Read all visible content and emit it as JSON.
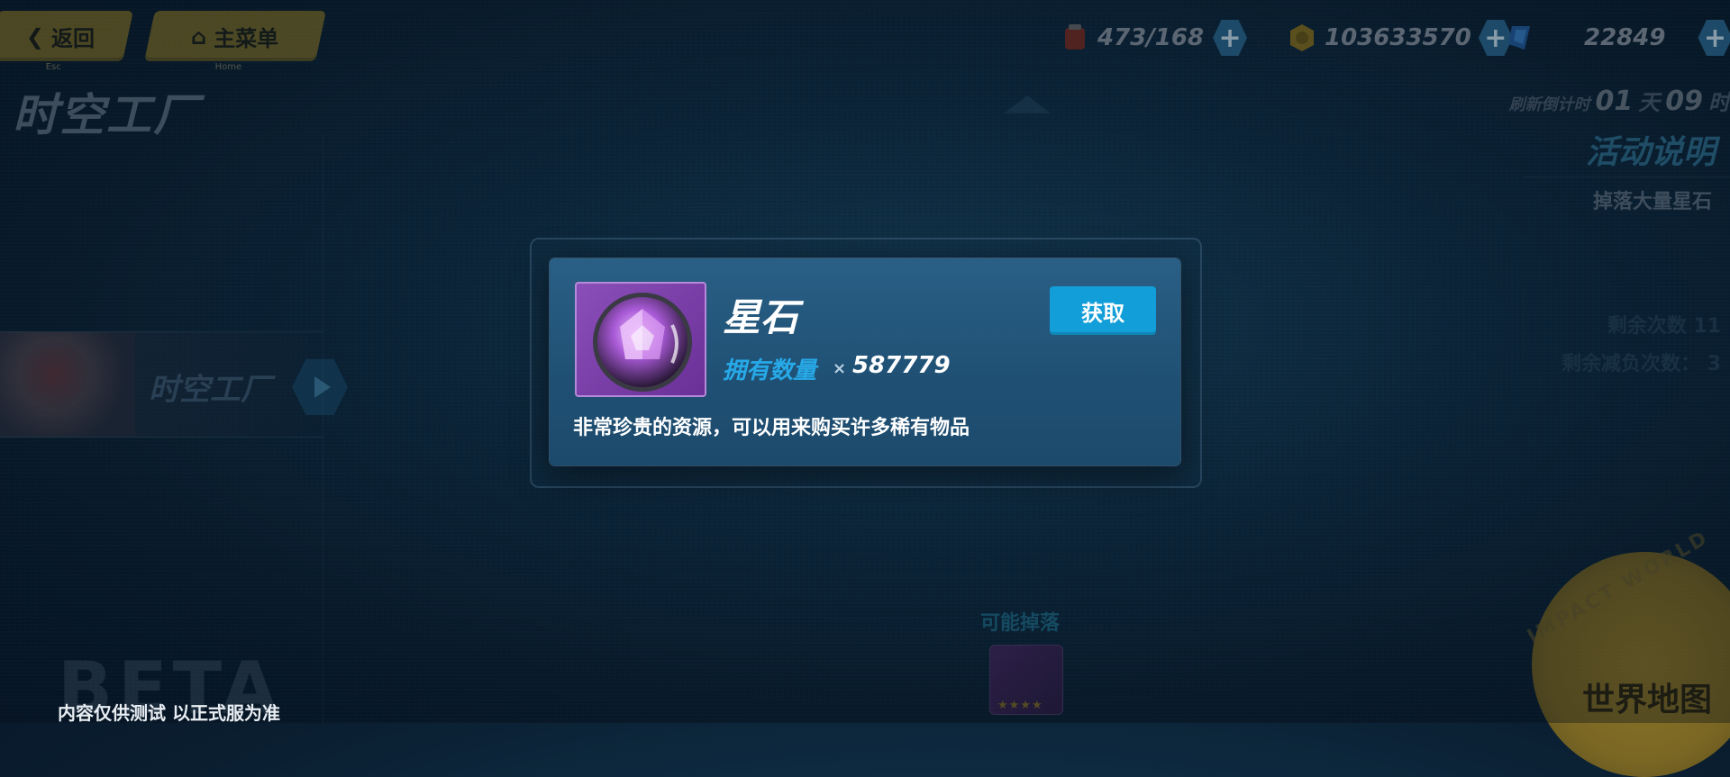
{
  "header": {
    "back": {
      "label": "返回",
      "sub": "Esc"
    },
    "home": {
      "label": "主菜单",
      "sub": "Home"
    },
    "title": "时空工厂"
  },
  "currencies": [
    {
      "name": "stamina",
      "value": "473/168",
      "icon": "stamina-icon",
      "color": "#a83a2a"
    },
    {
      "name": "coins",
      "value": "103633570",
      "icon": "coin-icon",
      "color": "#c9a326"
    },
    {
      "name": "crystals",
      "value": "22849",
      "icon": "crystal-icon",
      "color": "#2f7fd0"
    }
  ],
  "refresh": {
    "label": "刷新倒计时",
    "days": "01",
    "day_unit": "天",
    "hours": "09",
    "hour_unit": "时"
  },
  "activity": {
    "title": "活动说明",
    "desc": "掉落大量星石",
    "remaining_label": "剩余次数",
    "remaining": "11",
    "remaining_reduce_label": "剩余减负次数：",
    "remaining_reduce": "3"
  },
  "banner": {
    "label": "时空工厂"
  },
  "drops": {
    "label": "可能掉落",
    "stars": "★★★★"
  },
  "footer": {
    "beta": "BETA",
    "note": "内容仅供测试 以正式服为准"
  },
  "world_map": {
    "label": "世界地图",
    "ring": "IMPACT WORLD"
  },
  "modal": {
    "item_name": "星石",
    "owned_label": "拥有数量",
    "owned_prefix": "×",
    "owned_count": "587779",
    "obtain_button": "获取",
    "description": "非常珍贵的资源，可以用来购买许多稀有物品"
  },
  "colors": {
    "accent": "#129ed8",
    "gold": "#c9a326",
    "highlight": "#27a9e8",
    "gem": "#8a4fb8"
  }
}
